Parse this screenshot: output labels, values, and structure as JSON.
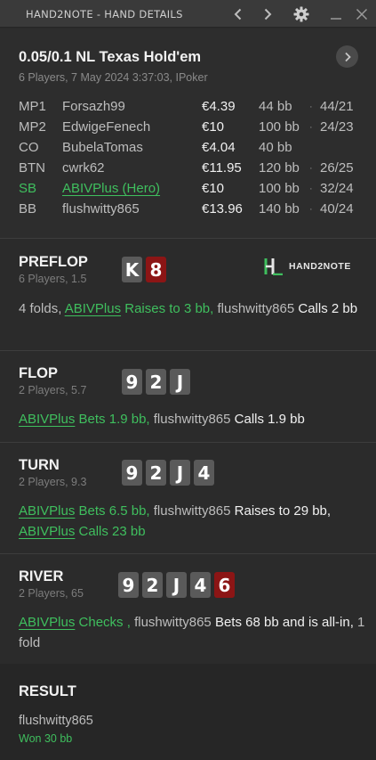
{
  "window": {
    "title": "HAND2NOTE - HAND DETAILS",
    "icons": [
      "chevron-left-icon",
      "chevron-right-icon",
      "gear-icon",
      "minimize-icon",
      "close-icon"
    ]
  },
  "hand": {
    "title": "0.05/0.1 NL Texas Hold'em",
    "subtitle": "6 Players, 7 May 2024 3:37:03, IPoker"
  },
  "players": [
    {
      "pos": "MP1",
      "name": "Forsazh99",
      "stack": "€4.39",
      "bb": "44 bb",
      "sep": "·",
      "vpip": "44/21"
    },
    {
      "pos": "MP2",
      "name": "EdwigeFenech",
      "stack": "€10",
      "bb": "100 bb",
      "sep": "·",
      "vpip": "24/23"
    },
    {
      "pos": "CO",
      "name": "BubelaTomas",
      "stack": "€4.04",
      "bb": "40 bb",
      "sep": "",
      "vpip": ""
    },
    {
      "pos": "BTN",
      "name": "cwrk62",
      "stack": "€11.95",
      "bb": "120 bb",
      "sep": "·",
      "vpip": "26/25"
    },
    {
      "pos": "SB",
      "name": "ABIVPlus (Hero)",
      "stack": "€10",
      "bb": "100 bb",
      "sep": "·",
      "vpip": "32/24"
    },
    {
      "pos": "BB",
      "name": "flushwitty865",
      "stack": "€13.96",
      "bb": "140 bb",
      "sep": "·",
      "vpip": "40/24"
    }
  ],
  "brand": {
    "logo_text": "HAND2NOTE",
    "accent": "#3fbf5e"
  },
  "preflop": {
    "title": "PREFLOP",
    "subtitle": "6 Players, 1.5",
    "cards": [
      {
        "rank": "K",
        "suit": "black"
      },
      {
        "rank": "8",
        "suit": "red"
      }
    ],
    "a1": "4 folds, ",
    "a2": "ABIVPlus",
    "a3": " Raises to 3 bb, ",
    "a4": "flushwitty865",
    "a5": " Calls 2 bb"
  },
  "flop": {
    "title": "FLOP",
    "subtitle": "2 Players, 5.7",
    "cards": [
      {
        "rank": "9",
        "suit": "black"
      },
      {
        "rank": "2",
        "suit": "black"
      },
      {
        "rank": "J",
        "suit": "black"
      }
    ],
    "a1": "ABIVPlus",
    "a2": " Bets 1.9 bb, ",
    "a3": "flushwitty865",
    "a4": " Calls 1.9 bb"
  },
  "turn": {
    "title": "TURN",
    "subtitle": "2 Players, 9.3",
    "cards": [
      {
        "rank": "9",
        "suit": "black"
      },
      {
        "rank": "2",
        "suit": "black"
      },
      {
        "rank": "J",
        "suit": "black"
      },
      {
        "rank": "4",
        "suit": "black"
      }
    ],
    "a1": "ABIVPlus",
    "a2": " Bets 6.5 bb, ",
    "a3": "flushwitty865",
    "a4": " Raises to 29 bb, ",
    "a5": "ABIVPlus",
    "a6": " Calls 23 bb"
  },
  "river": {
    "title": "RIVER",
    "subtitle": "2 Players, 65",
    "cards": [
      {
        "rank": "9",
        "suit": "black"
      },
      {
        "rank": "2",
        "suit": "black"
      },
      {
        "rank": "J",
        "suit": "black"
      },
      {
        "rank": "4",
        "suit": "black"
      },
      {
        "rank": "6",
        "suit": "red"
      }
    ],
    "a1": "ABIVPlus",
    "a2": " Checks , ",
    "a3": "flushwitty865",
    "a4": " Bets 68 bb and is all-in, ",
    "a5": "1 fold"
  },
  "result": {
    "title": "RESULT",
    "winner": "flushwitty865",
    "won": "Won 30 bb"
  }
}
